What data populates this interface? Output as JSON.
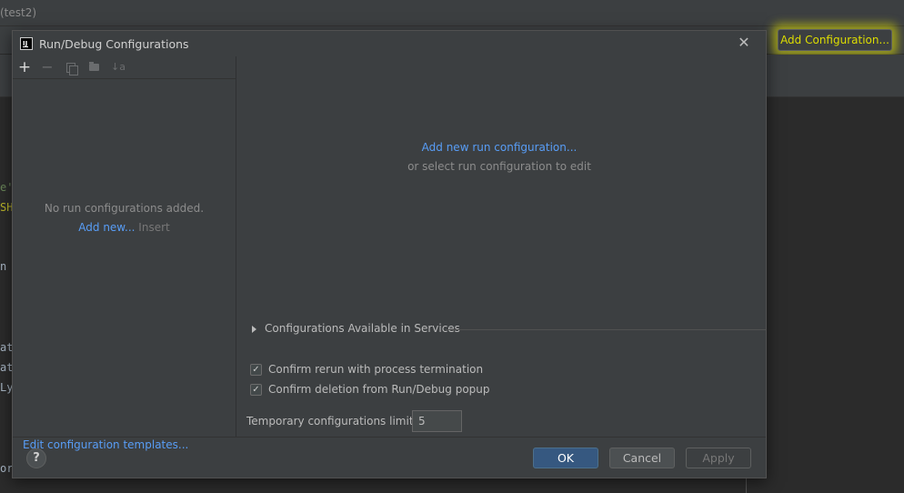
{
  "ide": {
    "window_title": "(test2)",
    "add_configuration_label": "Add Configuration...",
    "code_fragments": [
      "e'",
      "SH",
      "n",
      "at",
      "at",
      "Ly",
      "or"
    ]
  },
  "dialog": {
    "title": "Run/Debug Configurations",
    "app_icon_text": "IJ",
    "left_pane": {
      "toolbar": {
        "add": "+",
        "remove": "−",
        "sort": "↓a"
      },
      "empty_message": "No run configurations added.",
      "add_new_link": "Add new...",
      "add_new_shortcut": "Insert",
      "edit_templates_link": "Edit configuration templates..."
    },
    "right_pane": {
      "add_new_run_config_link": "Add new run configuration...",
      "select_hint": "or select run configuration to edit",
      "services_label": "Configurations Available in Services",
      "confirm_rerun": {
        "label": "Confirm rerun with process termination",
        "checked": true
      },
      "confirm_deletion": {
        "label": "Confirm deletion from Run/Debug popup",
        "checked": true
      },
      "temp_limit_label": "Temporary configurations limit:",
      "temp_limit_value": "5"
    },
    "footer": {
      "help": "?",
      "ok": "OK",
      "cancel": "Cancel",
      "apply": "Apply"
    }
  },
  "colors": {
    "link": "#589df6",
    "highlight": "#dddd00",
    "ok_button": "#365880"
  }
}
